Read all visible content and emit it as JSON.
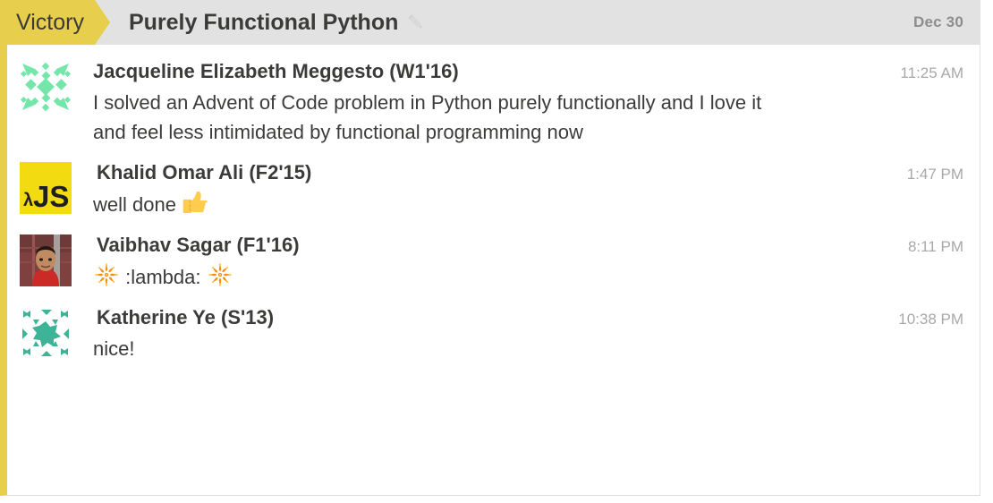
{
  "header": {
    "tag": "Victory",
    "title": "Purely Functional Python",
    "edit_icon": "pencil-icon",
    "date": "Dec 30",
    "tag_color": "#E8CE4D",
    "background_color": "#E2E2E2"
  },
  "messages": [
    {
      "author": "Jacqueline Elizabeth Meggesto (W1'16)",
      "text": "I solved an Advent of Code problem in Python purely functionally and I love it and feel less intimidated by functional programming now",
      "time": "11:25 AM",
      "avatar": {
        "type": "identicon",
        "name": "identicon-avatar-mint",
        "color": "#74E6AA"
      }
    },
    {
      "author": "Khalid Omar Ali (F2'15)",
      "text": "well done ",
      "emoji_after": "thumbs-up-emoji",
      "time": "1:47 PM",
      "avatar": {
        "type": "logo",
        "name": "lambda-js-avatar",
        "label": "λJS",
        "color": "#F2DB10",
        "text_color": "#1F1F1F"
      }
    },
    {
      "author": "Vaibhav Sagar (F1'16)",
      "text": ":lambda:",
      "emoji_before": "sparkler-emoji",
      "emoji_after": "sparkler-emoji",
      "time": "8:11 PM",
      "avatar": {
        "type": "photo",
        "name": "photo-avatar-person",
        "color": "#8E4A49"
      }
    },
    {
      "author": "Katherine Ye (S'13)",
      "text": "nice!",
      "time": "10:38 PM",
      "avatar": {
        "type": "identicon",
        "name": "identicon-avatar-teal",
        "color": "#3DB397"
      }
    }
  ]
}
